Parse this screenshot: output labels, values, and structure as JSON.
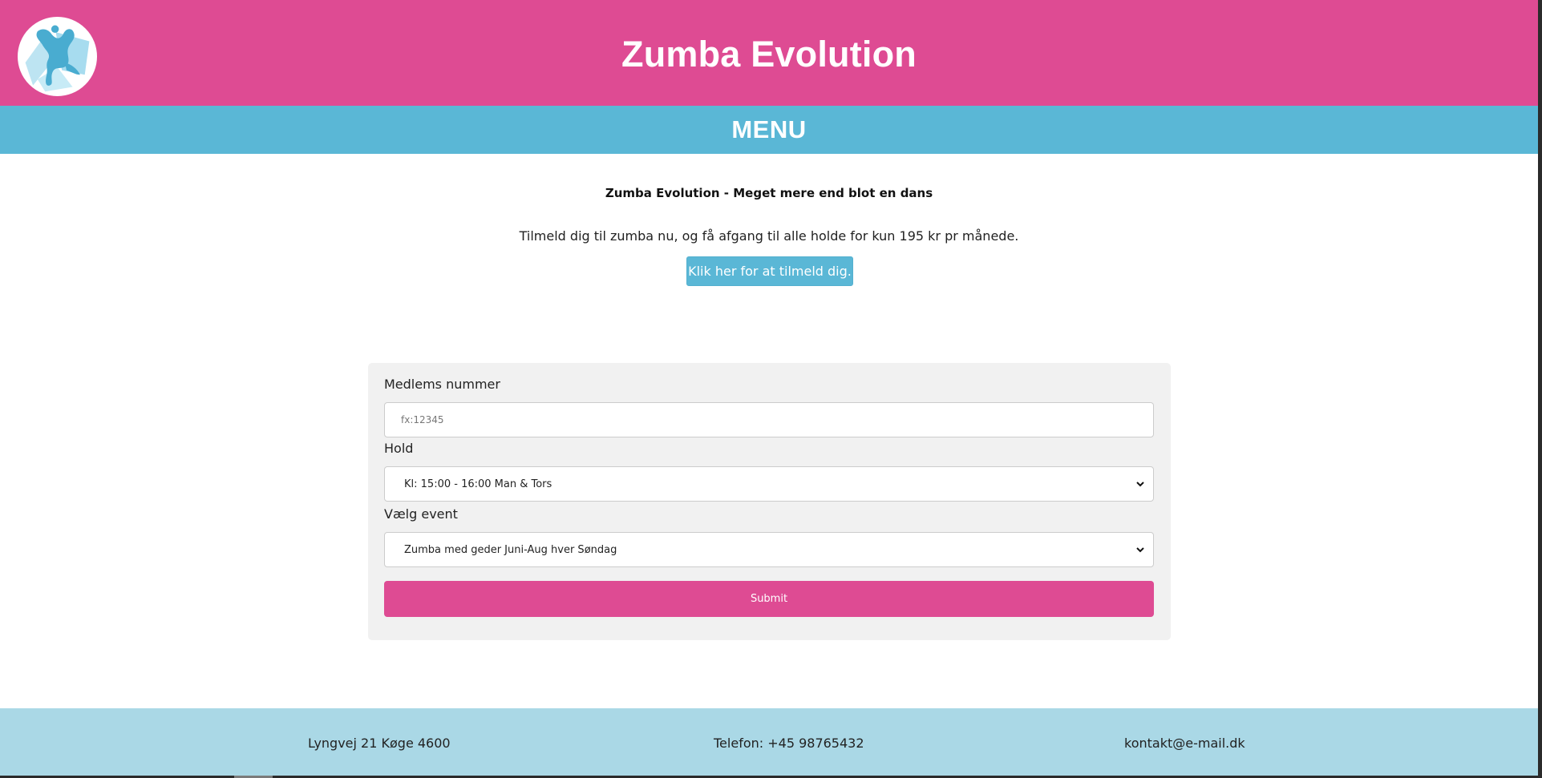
{
  "header": {
    "title": "Zumba Evolution",
    "logo_icon": "zumba-dancer-logo"
  },
  "menu": {
    "label": "MENU"
  },
  "intro": {
    "tagline": "Zumba Evolution - Meget mere end blot en dans",
    "text": "Tilmeld dig til zumba nu, og få afgang til alle holde for kun 195 kr pr månede.",
    "signup_button": "Klik her for at tilmeld dig."
  },
  "form": {
    "member_label": "Medlems nummer",
    "member_placeholder": "fx:12345",
    "member_value": "",
    "team_label": "Hold",
    "team_selected": "Kl: 15:00 - 16:00 Man & Tors",
    "event_label": "Vælg event",
    "event_selected": "Zumba med geder Juni-Aug hver Søndag",
    "submit_label": "Submit"
  },
  "footer": {
    "address": "Lyngvej 21 Køge 4600",
    "phone": "Telefon: +45 98765432",
    "email": "kontakt@e-mail.dk"
  },
  "colors": {
    "header_pink": "#de4b93",
    "menu_blue": "#5ab7d6",
    "footer_light_blue": "#aad8e6",
    "form_background": "#f1f1f1"
  }
}
